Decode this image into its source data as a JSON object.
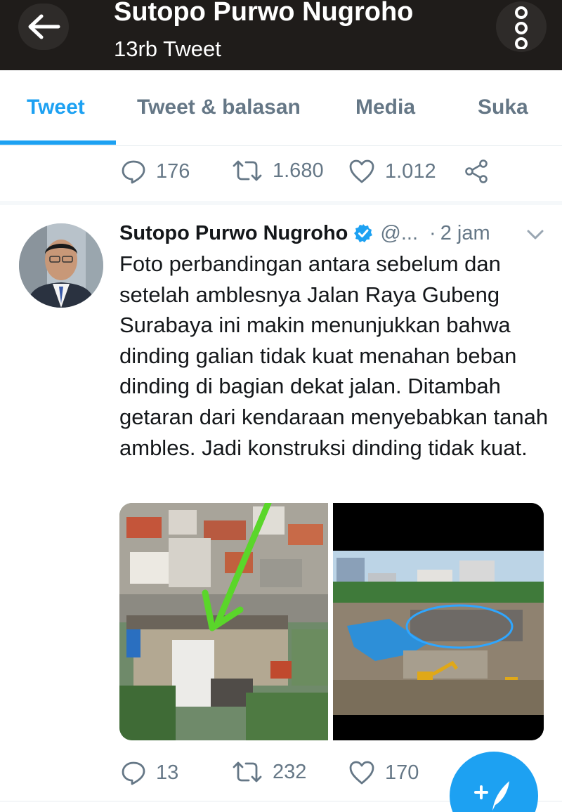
{
  "header": {
    "title": "Sutopo Purwo Nugroho",
    "subtitle": "13rb Tweet"
  },
  "tabs": [
    {
      "label": "Tweet",
      "active": true
    },
    {
      "label": "Tweet & balasan",
      "active": false
    },
    {
      "label": "Media",
      "active": false
    },
    {
      "label": "Suka",
      "active": false
    }
  ],
  "previous_tweet": {
    "replies": "176",
    "retweets": "1.680",
    "likes": "1.012"
  },
  "tweet": {
    "author_name": "Sutopo Purwo Nugroho",
    "handle": "@...",
    "separator": "·",
    "time": "2 jam",
    "text": "Foto perbandingan antara sebelum dan setelah amblesnya Jalan Raya Gubeng Surabaya ini makin menunjukkan bahwa dinding galian tidak kuat menahan beban dinding di bagian dekat jalan. Ditambah getaran dari kendaraan menyebabkan tanah ambles. Jadi konstruksi dinding tidak kuat.",
    "replies": "13",
    "retweets": "232",
    "likes": "170"
  },
  "colors": {
    "accent": "#1da1f2",
    "header_bg": "#1f1c1a",
    "muted": "#657786"
  },
  "icons": {
    "back": "arrow-left-icon",
    "more": "more-vertical-icon",
    "reply": "reply-icon",
    "retweet": "retweet-icon",
    "like": "heart-icon",
    "share": "share-icon",
    "verified": "verified-badge-icon",
    "chevron": "chevron-down-icon",
    "compose": "compose-tweet-icon"
  }
}
